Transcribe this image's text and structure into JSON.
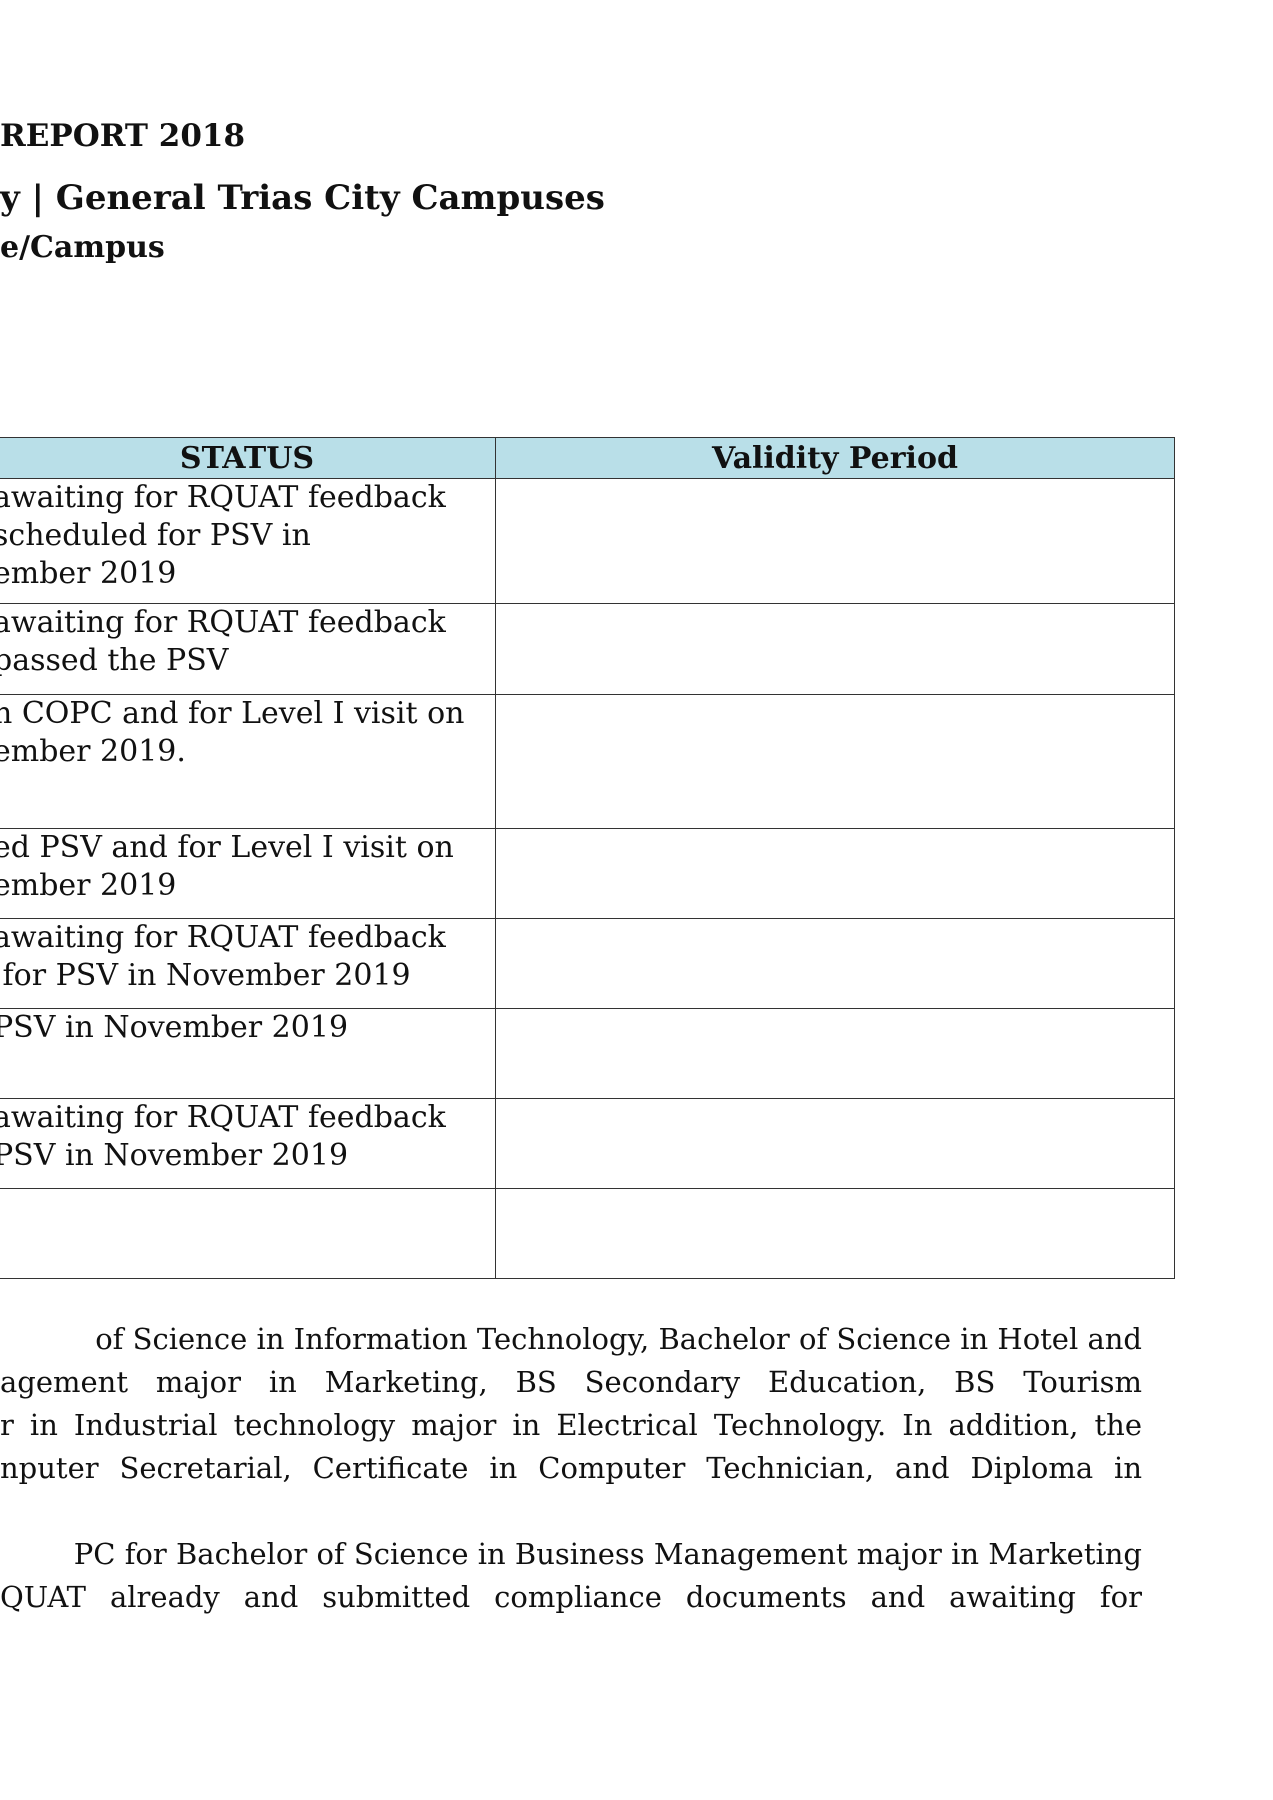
{
  "header": {
    "title_line": "REPORT 2018",
    "campuses_line": "y | General Trias City Campuses",
    "subtitle_line": "e/Campus"
  },
  "table": {
    "columns": [
      "STATUS",
      "Validity Period"
    ],
    "rows": [
      {
        "status": "awaiting for RQUAT feedback\nscheduled for PSV in\nember 2019",
        "validity": ""
      },
      {
        "status": "awaiting for RQUAT feedback\npassed the PSV",
        "validity": ""
      },
      {
        "status": "n COPC and for Level I visit on\nember 2019.",
        "validity": ""
      },
      {
        "status": "ed PSV and for Level I visit on\nember 2019",
        "validity": ""
      },
      {
        "status": "awaiting for RQUAT feedback\n for PSV in November 2019",
        "validity": ""
      },
      {
        "status": "PSV in November 2019",
        "validity": ""
      },
      {
        "status": "awaiting for RQUAT feedback\nPSV in November 2019",
        "validity": ""
      },
      {
        "status": "",
        "validity": ""
      }
    ]
  },
  "paragraphs": [
    {
      "lines": [
        "of Science in Information Technology, Bachelor of Science in Hotel and",
        "agement major in Marketing, BS Secondary Education, BS Tourism",
        "r in Industrial technology major in Electrical Technology. In addition, the",
        "nputer Secretarial, Certificate in Computer Technician, and Diploma in"
      ]
    },
    {
      "lines": [
        "PC for Bachelor of Science in Business Management major in Marketing",
        "QUAT already and submitted compliance documents and awaiting for"
      ]
    }
  ]
}
